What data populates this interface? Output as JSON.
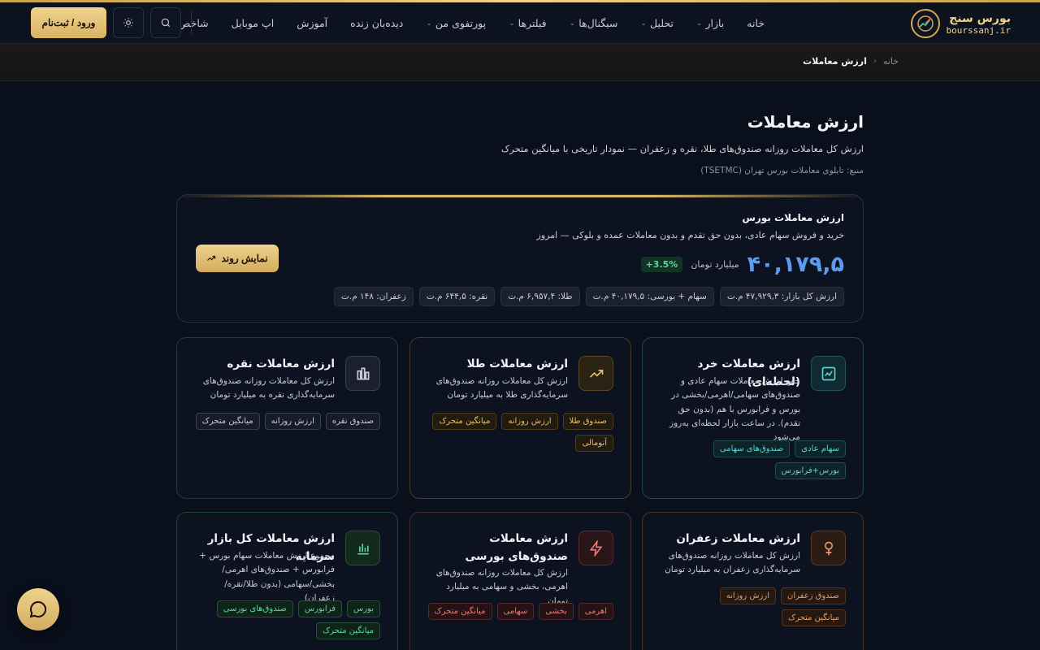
{
  "brand": {
    "name_fa": "بورس سنج",
    "name_en": "bourssanj.ir",
    "accent": "#d4a84a"
  },
  "nav": {
    "items": [
      {
        "label": "خانه",
        "dropdown": false
      },
      {
        "label": "بازار",
        "dropdown": true
      },
      {
        "label": "تحلیل",
        "dropdown": true
      },
      {
        "label": "سیگنال‌ها",
        "dropdown": true
      },
      {
        "label": "فیلترها",
        "dropdown": true
      },
      {
        "label": "پورتفوی من",
        "dropdown": true
      },
      {
        "label": "دیده‌بان زنده",
        "dropdown": false
      },
      {
        "label": "آموزش",
        "dropdown": false
      },
      {
        "label": "اپ موبایل",
        "dropdown": false
      },
      {
        "label": "شاخص",
        "dropdown": true
      }
    ],
    "login_label": "ورود / ثبت‌نام",
    "search_icon": "search-icon",
    "theme_icon": "sun-icon"
  },
  "breadcrumb": {
    "home": "خانه",
    "current": "ارزش معاملات"
  },
  "page": {
    "title": "ارزش معاملات",
    "subtitle": "ارزش کل معاملات روزانه صندوق‌های طلا، نقره و زعفران — نمودار تاریخی با میانگین متحرک",
    "source": "منبع: تابلوی معاملات بورس تهران (TSETMC)"
  },
  "hero": {
    "title": "ارزش معاملات بورس",
    "subtitle": "خرید و فروش سهام عادی، بدون حق تقدم و بدون معاملات عمده و بلوکی — امروز",
    "value": "۴۰,۱۷۹,۵",
    "unit": "میلیارد تومان",
    "delta": "+3.5%",
    "chips": [
      "ارزش کل بازار: ۴۷,۹۲۹,۳ م.ت",
      "سهام + بورسی: ۴۰,۱۷۹,۵ م.ت",
      "طلا: ۶,۹۵۷,۴ م.ت",
      "نقره: ۶۴۴,۵ م.ت",
      "زعفران: ۱۴۸ م.ت"
    ],
    "trend_button": "نمایش روند"
  },
  "cards": [
    {
      "title": "ارزش معاملات خرد (لحظه‌ای)",
      "desc": "جمع ارزش معاملات سهام عادی و صندوق‌های سهامی/اهرمی/بخشی در بورس و فرابورس با هم (بدون حق تقدم). در ساعت بازار لحظه‌ای به‌روز می‌شود",
      "tags": [
        "سهام عادی",
        "صندوق‌های سهامی",
        "بورس+فرابورس"
      ],
      "icon": "chart-line-icon",
      "color": "#5fd0d6"
    },
    {
      "title": "ارزش معاملات طلا",
      "desc": "ارزش کل معاملات روزانه صندوق‌های سرمایه‌گذاری طلا به میلیارد تومان",
      "tags": [
        "صندوق طلا",
        "ارزش روزانه",
        "میانگین متحرک",
        "آنومالی"
      ],
      "icon": "trending-up-icon",
      "color": "#e6bf6a"
    },
    {
      "title": "ارزش معاملات نقره",
      "desc": "ارزش کل معاملات روزانه صندوق‌های سرمایه‌گذاری نقره به میلیارد تومان",
      "tags": [
        "صندوق نقره",
        "ارزش روزانه",
        "میانگین متحرک"
      ],
      "icon": "bar-chart-icon",
      "color": "#c8ccd6"
    },
    {
      "title": "ارزش معاملات زعفران",
      "desc": "ارزش کل معاملات روزانه صندوق‌های سرمایه‌گذاری زعفران به میلیارد تومان",
      "tags": [
        "صندوق زعفران",
        "ارزش روزانه",
        "میانگین متحرک"
      ],
      "icon": "flower-icon",
      "color": "#e89a6a"
    },
    {
      "title": "ارزش معاملات صندوق‌های بورسی",
      "desc": "ارزش کل معاملات روزانه صندوق‌های اهرمی، بخشی و سهامی به میلیارد تومان",
      "tags": [
        "اهرمی",
        "بخشی",
        "سهامی",
        "میانگین متحرک"
      ],
      "icon": "lightning-icon",
      "color": "#e87a7a"
    },
    {
      "title": "ارزش معاملات کل بازار سرمایه",
      "desc": "مجموع ارزش معاملات سهام بورس + فرابورس + صندوق‌های اهرمی/بخشی/سهامی (بدون طلا/نقره/زعفران)",
      "tags": [
        "بورس",
        "فرابورس",
        "صندوق‌های بورسی",
        "میانگین متحرک"
      ],
      "icon": "column-chart-icon",
      "color": "#5fd49a"
    }
  ],
  "chat_icon": "chat-bubble-icon"
}
